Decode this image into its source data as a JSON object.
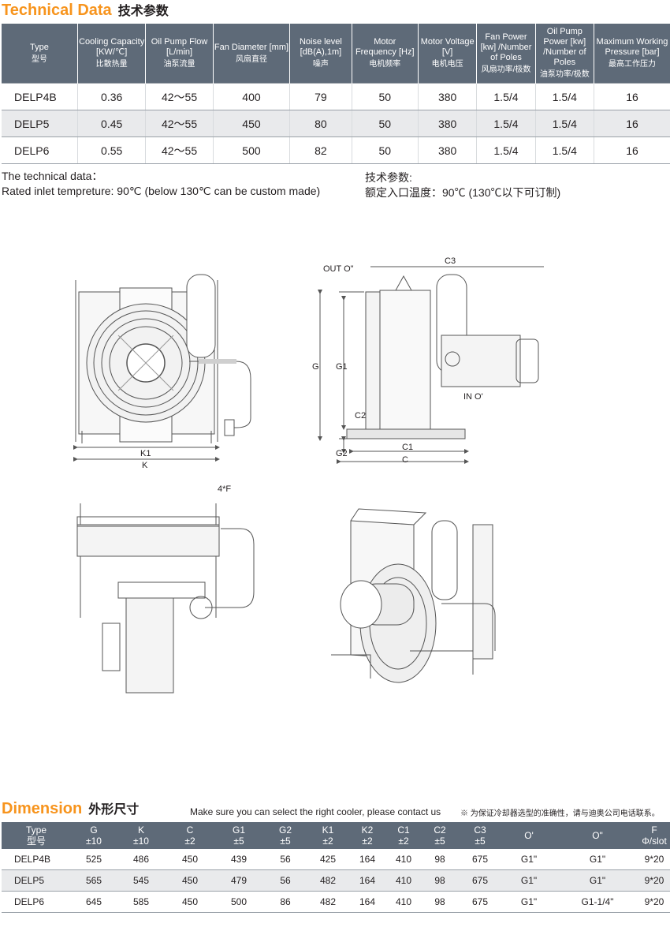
{
  "tech": {
    "title_en": "Technical Data",
    "title_zh": "技术参数",
    "headers": [
      {
        "en": "Type",
        "zh": "型号"
      },
      {
        "en": "Cooling Capacity [KW/℃]",
        "zh": "比散热量"
      },
      {
        "en": "Oil Pump Flow [L/min]",
        "zh": "油泵流量"
      },
      {
        "en": "Fan Diameter [mm]",
        "zh": "风扇直径"
      },
      {
        "en": "Noise level [dB(A),1m]",
        "zh": "噪声"
      },
      {
        "en": "Motor Frequency [Hz]",
        "zh": "电机频率"
      },
      {
        "en": "Motor Voltage [V]",
        "zh": "电机电压"
      },
      {
        "en": "Fan Power [kw] /Number of Poles",
        "zh": "风扇功率/极数"
      },
      {
        "en": "Oil Pump Power [kw] /Number of Poles",
        "zh": "油泵功率/极数"
      },
      {
        "en": "Maximum Working Pressure [bar]",
        "zh": "最高工作压力"
      }
    ],
    "rows": [
      [
        "DELP4B",
        "0.36",
        "42～55",
        "400",
        "79",
        "50",
        "380",
        "1.5/4",
        "1.5/4",
        "16"
      ],
      [
        "DELP5",
        "0.45",
        "42～55",
        "450",
        "80",
        "50",
        "380",
        "1.5/4",
        "1.5/4",
        "16"
      ],
      [
        "DELP6",
        "0.55",
        "42～55",
        "500",
        "82",
        "50",
        "380",
        "1.5/4",
        "1.5/4",
        "16"
      ]
    ]
  },
  "notes": {
    "en_line1": "The technical data：",
    "en_line2": "Rated inlet tempreture: 90℃ (below 130℃ can be custom made)",
    "zh_line1": "技术参数:",
    "zh_line2": "额定入口温度：90℃ (130℃以下可订制)"
  },
  "drawing_labels": {
    "k1": "K1",
    "k": "K",
    "out": "OUT O\"",
    "in": "IN O'",
    "c3": "C3",
    "g": "G",
    "g1": "G1",
    "c2": "C2",
    "g2": "G2",
    "c1": "C1",
    "c": "C",
    "f": "4*F"
  },
  "dimension": {
    "title_en": "Dimension",
    "title_zh": "外形尺寸",
    "note_en": "Make sure you can select the right cooler, please contact us",
    "note_zh": "※ 为保证冷却器选型的准确性，请与迪奥公司电话联系。",
    "headers": [
      {
        "a": "Type",
        "b": "型号"
      },
      {
        "a": "G",
        "b": "±10"
      },
      {
        "a": "K",
        "b": "±10"
      },
      {
        "a": "C",
        "b": "±2"
      },
      {
        "a": "G1",
        "b": "±5"
      },
      {
        "a": "G2",
        "b": "±5"
      },
      {
        "a": "K1",
        "b": "±2"
      },
      {
        "a": "K2",
        "b": "±2"
      },
      {
        "a": "C1",
        "b": "±2"
      },
      {
        "a": "C2",
        "b": "±5"
      },
      {
        "a": "C3",
        "b": "±5"
      },
      {
        "a": "O'",
        "b": ""
      },
      {
        "a": "O\"",
        "b": ""
      },
      {
        "a": "F",
        "b": "Φ/slot"
      }
    ],
    "rows": [
      [
        "DELP4B",
        "525",
        "486",
        "450",
        "439",
        "56",
        "425",
        "164",
        "410",
        "98",
        "675",
        "G1\"",
        "G1\"",
        "9*20"
      ],
      [
        "DELP5",
        "565",
        "545",
        "450",
        "479",
        "56",
        "482",
        "164",
        "410",
        "98",
        "675",
        "G1\"",
        "G1\"",
        "9*20"
      ],
      [
        "DELP6",
        "645",
        "585",
        "450",
        "500",
        "86",
        "482",
        "164",
        "410",
        "98",
        "675",
        "G1\"",
        "G1-1/4\"",
        "9*20"
      ]
    ]
  }
}
